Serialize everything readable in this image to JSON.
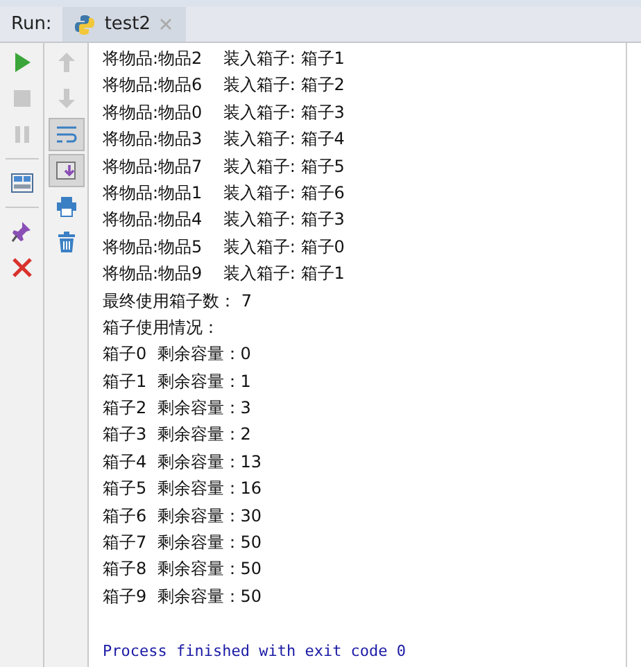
{
  "run_panel": {
    "label": "Run:",
    "tabs": [
      {
        "title": "test2",
        "selected": true
      }
    ]
  },
  "console": {
    "lines": [
      {
        "kind": "stdout",
        "text": "将物品:物品2    装入箱子: 箱子1"
      },
      {
        "kind": "stdout",
        "text": "将物品:物品6    装入箱子: 箱子2"
      },
      {
        "kind": "stdout",
        "text": "将物品:物品0    装入箱子: 箱子3"
      },
      {
        "kind": "stdout",
        "text": "将物品:物品3    装入箱子: 箱子4"
      },
      {
        "kind": "stdout",
        "text": "将物品:物品7    装入箱子: 箱子5"
      },
      {
        "kind": "stdout",
        "text": "将物品:物品1    装入箱子: 箱子6"
      },
      {
        "kind": "stdout",
        "text": "将物品:物品4    装入箱子: 箱子3"
      },
      {
        "kind": "stdout",
        "text": "将物品:物品5    装入箱子: 箱子0"
      },
      {
        "kind": "stdout",
        "text": "将物品:物品9    装入箱子: 箱子1"
      },
      {
        "kind": "stdout",
        "text": "最终使用箱子数： 7"
      },
      {
        "kind": "stdout",
        "text": "箱子使用情况："
      },
      {
        "kind": "stdout",
        "text": "箱子0  剩余容量：0"
      },
      {
        "kind": "stdout",
        "text": "箱子1  剩余容量：1"
      },
      {
        "kind": "stdout",
        "text": "箱子2  剩余容量：3"
      },
      {
        "kind": "stdout",
        "text": "箱子3  剩余容量：2"
      },
      {
        "kind": "stdout",
        "text": "箱子4  剩余容量：13"
      },
      {
        "kind": "stdout",
        "text": "箱子5  剩余容量：16"
      },
      {
        "kind": "stdout",
        "text": "箱子6  剩余容量：30"
      },
      {
        "kind": "stdout",
        "text": "箱子7  剩余容量：50"
      },
      {
        "kind": "stdout",
        "text": "箱子8  剩余容量：50"
      },
      {
        "kind": "stdout",
        "text": "箱子9  剩余容量：50"
      },
      {
        "kind": "blank"
      },
      {
        "kind": "system",
        "text": "Process finished with exit code 0"
      }
    ]
  }
}
